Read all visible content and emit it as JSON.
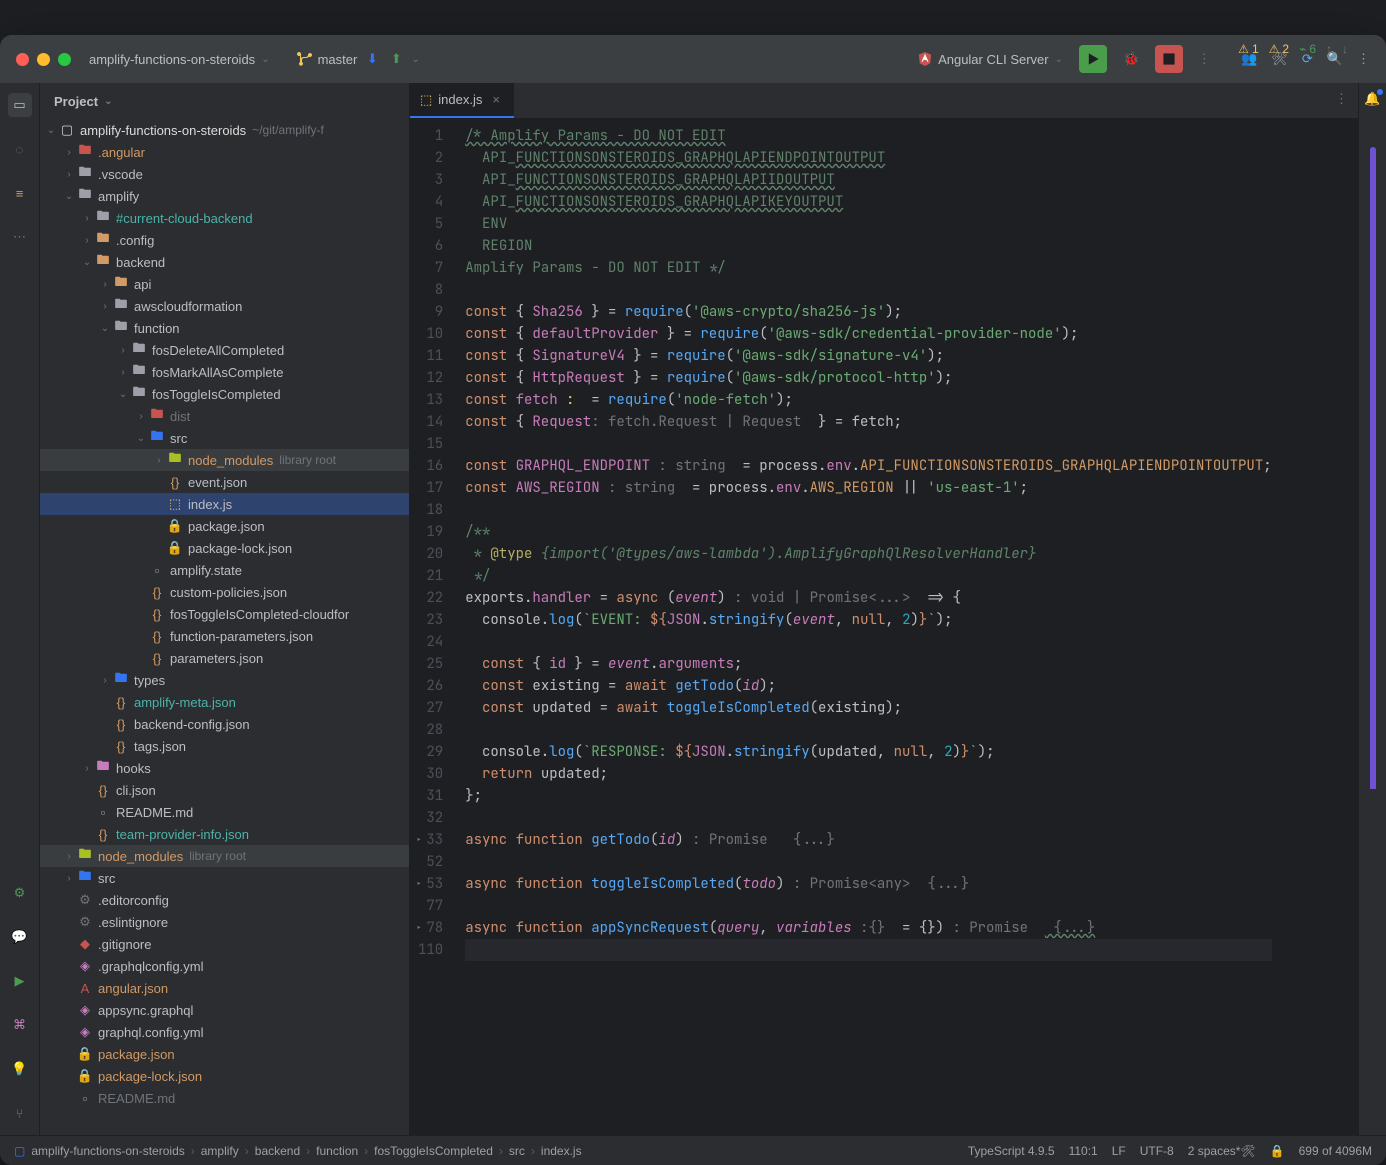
{
  "titlebar": {
    "project": "amplify-functions-on-steroids",
    "branch": "master",
    "run_config": "Angular CLI Server"
  },
  "sidebar": {
    "title": "Project"
  },
  "tree": [
    {
      "d": 0,
      "arr": "v",
      "ic": "folder-root",
      "name": "amplify-functions-on-steroids",
      "suf": "~/git/amplify-f",
      "cls": "white"
    },
    {
      "d": 1,
      "arr": ">",
      "ic": "folder-ng",
      "name": ".angular",
      "cls": "orange"
    },
    {
      "d": 1,
      "arr": ">",
      "ic": "folder",
      "name": ".vscode"
    },
    {
      "d": 1,
      "arr": "v",
      "ic": "folder",
      "name": "amplify"
    },
    {
      "d": 2,
      "arr": ">",
      "ic": "folder",
      "name": "#current-cloud-backend",
      "cls": "teal"
    },
    {
      "d": 2,
      "arr": ">",
      "ic": "folder-cfg",
      "name": ".config"
    },
    {
      "d": 2,
      "arr": "v",
      "ic": "folder-be",
      "name": "backend"
    },
    {
      "d": 3,
      "arr": ">",
      "ic": "folder-y",
      "name": "api"
    },
    {
      "d": 3,
      "arr": ">",
      "ic": "folder",
      "name": "awscloudformation"
    },
    {
      "d": 3,
      "arr": "v",
      "ic": "folder",
      "name": "function"
    },
    {
      "d": 4,
      "arr": ">",
      "ic": "folder",
      "name": "fosDeleteAllCompleted"
    },
    {
      "d": 4,
      "arr": ">",
      "ic": "folder",
      "name": "fosMarkAllAsComplete"
    },
    {
      "d": 4,
      "arr": "v",
      "ic": "folder",
      "name": "fosToggleIsCompleted"
    },
    {
      "d": 5,
      "arr": ">",
      "ic": "folder-red",
      "name": "dist",
      "cls": "grey"
    },
    {
      "d": 5,
      "arr": "v",
      "ic": "folder-src",
      "name": "src"
    },
    {
      "d": 6,
      "arr": ">",
      "ic": "folder-lib",
      "name": "node_modules",
      "suf": "library root",
      "cls": "orange",
      "hil": true
    },
    {
      "d": 6,
      "arr": "",
      "ic": "json",
      "name": "event.json"
    },
    {
      "d": 6,
      "arr": "",
      "ic": "js",
      "name": "index.js",
      "sel": true
    },
    {
      "d": 6,
      "arr": "",
      "ic": "json-r",
      "name": "package.json"
    },
    {
      "d": 6,
      "arr": "",
      "ic": "json-r",
      "name": "package-lock.json"
    },
    {
      "d": 5,
      "arr": "",
      "ic": "file",
      "name": "amplify.state"
    },
    {
      "d": 5,
      "arr": "",
      "ic": "json",
      "name": "custom-policies.json"
    },
    {
      "d": 5,
      "arr": "",
      "ic": "json",
      "name": "fosToggleIsCompleted-cloudfor"
    },
    {
      "d": 5,
      "arr": "",
      "ic": "json",
      "name": "function-parameters.json"
    },
    {
      "d": 5,
      "arr": "",
      "ic": "json",
      "name": "parameters.json"
    },
    {
      "d": 3,
      "arr": ">",
      "ic": "folder-ts",
      "name": "types"
    },
    {
      "d": 3,
      "arr": "",
      "ic": "json",
      "name": "amplify-meta.json",
      "cls": "teal"
    },
    {
      "d": 3,
      "arr": "",
      "ic": "json",
      "name": "backend-config.json"
    },
    {
      "d": 3,
      "arr": "",
      "ic": "json",
      "name": "tags.json"
    },
    {
      "d": 2,
      "arr": ">",
      "ic": "folder-p",
      "name": "hooks"
    },
    {
      "d": 2,
      "arr": "",
      "ic": "json",
      "name": "cli.json"
    },
    {
      "d": 2,
      "arr": "",
      "ic": "md",
      "name": "README.md"
    },
    {
      "d": 2,
      "arr": "",
      "ic": "json",
      "name": "team-provider-info.json",
      "cls": "teal"
    },
    {
      "d": 1,
      "arr": ">",
      "ic": "folder-lib",
      "name": "node_modules",
      "suf": "library root",
      "cls": "orange",
      "hil": true
    },
    {
      "d": 1,
      "arr": ">",
      "ic": "folder-src",
      "name": "src"
    },
    {
      "d": 1,
      "arr": "",
      "ic": "cfg",
      "name": ".editorconfig"
    },
    {
      "d": 1,
      "arr": "",
      "ic": "cfg",
      "name": ".eslintignore"
    },
    {
      "d": 1,
      "arr": "",
      "ic": "git",
      "name": ".gitignore"
    },
    {
      "d": 1,
      "arr": "",
      "ic": "gql",
      "name": ".graphqlconfig.yml"
    },
    {
      "d": 1,
      "arr": "",
      "ic": "ng",
      "name": "angular.json",
      "cls": "orange"
    },
    {
      "d": 1,
      "arr": "",
      "ic": "gql",
      "name": "appsync.graphql"
    },
    {
      "d": 1,
      "arr": "",
      "ic": "gql",
      "name": "graphql.config.yml"
    },
    {
      "d": 1,
      "arr": "",
      "ic": "json-r",
      "name": "package.json",
      "cls": "orange"
    },
    {
      "d": 1,
      "arr": "",
      "ic": "json-r",
      "name": "package-lock.json",
      "cls": "orange"
    },
    {
      "d": 1,
      "arr": "",
      "ic": "md",
      "name": "README.md",
      "cls": "grey"
    }
  ],
  "tab": {
    "name": "index.js"
  },
  "warnings": {
    "err": "1",
    "warn": "2",
    "weak": "6"
  },
  "code": {
    "lines": [
      1,
      2,
      3,
      4,
      5,
      6,
      7,
      8,
      9,
      10,
      11,
      12,
      13,
      14,
      15,
      16,
      17,
      18,
      19,
      20,
      21,
      22,
      23,
      24,
      25,
      26,
      27,
      28,
      29,
      30,
      31,
      32,
      33,
      52,
      53,
      77,
      78,
      110
    ],
    "l1a": "/* Amplify Params - DO NOT EDIT",
    "l2": "API_",
    "l2b": "FUNCTIONSONSTEROIDS_GRAPHQLAPIENDPOINTOUTPUT",
    "l3": "API_",
    "l3b": "FUNCTIONSONSTEROIDS_GRAPHQLAPIIDOUTPUT",
    "l4": "API_",
    "l4b": "FUNCTIONSONSTEROIDS_GRAPHQLAPIKEYOUTPUT",
    "l5": "ENV",
    "l6": "REGION",
    "l7": "Amplify Params - DO NOT EDIT */",
    "l9_kw": "const",
    "l9_b": "{ ",
    "l9_id": "Sha256",
    "l9_c": " } = ",
    "l9_fn": "require",
    "l9_s": "'@aws-crypto/sha256-js'",
    "l10_id": "defaultProvider",
    "l10_s": "'@aws-sdk/credential-provider-node'",
    "l11_id": "SignatureV4",
    "l11_s": "'@aws-sdk/signature-v4'",
    "l12_id": "HttpRequest",
    "l12_s": "'@aws-sdk/protocol-http'",
    "l13_id": "fetch",
    "l13_s": "'node-fetch'",
    "l14_id": "Request",
    "l14_t": ": fetch.Request | Request ",
    "l14_e": " = fetch;",
    "l16_id": "GRAPHQL_ENDPOINT",
    "l16_t": " : string ",
    "l16_e": " = process.",
    "l16_p": "env",
    "l16_q": ".",
    "l16_c": "API_FUNCTIONSONSTEROIDS_GRAPHQLAPIENDPOINTOUTPUT",
    "l17_id": "AWS_REGION",
    "l17_e": " = process.",
    "l17_c": "AWS_REGION",
    "l17_s": "'us-east-1'",
    "l19": "/**",
    "l20a": " * ",
    "l20b": "@type",
    "l20c": " {import('@types/aws-lambda').AmplifyGraphQlResolverHandler}",
    "l21": " */",
    "l22a": "exports.",
    "l22b": "handler",
    "l22c": " = ",
    "l22d": "async",
    "l22e": " (",
    "l22f": "event",
    "l22g": ")",
    "l22t": " : void | Promise<...> ",
    "l22h": " => {",
    "l23a": "console.",
    "l23b": "log",
    "l23c": "(",
    "l23d": "`EVENT: ",
    "l23e": "${",
    "l23f": "JSON",
    "l23g": ".",
    "l23h": "stringify",
    "l23i": "(",
    "l23j": "event",
    "l23k": ", ",
    "l23l": "null",
    "l23m": ", ",
    "l23n": "2",
    "l23o": ")}",
    "l23p": "`",
    "l23q": ");",
    "l25a": "const",
    "l25b": " { ",
    "l25c": "id",
    "l25d": " } = ",
    "l25e": "event",
    "l25f": ".",
    "l25g": "arguments",
    "l25h": ";",
    "l26a": "const",
    "l26b": " existing = ",
    "l26c": "await",
    "l26d": " ",
    "l26e": "getTodo",
    "l26f": "(",
    "l26g": "id",
    "l26h": ");",
    "l27a": "const",
    "l27b": " updated = ",
    "l27c": "await",
    "l27d": " ",
    "l27e": "toggleIsCompleted",
    "l27f": "(existing);",
    "l29a": "console.",
    "l29b": "log",
    "l29c": "(",
    "l29d": "`RESPONSE: ",
    "l29e": "${",
    "l29f": "JSON",
    "l29g": ".",
    "l29h": "stringify",
    "l29i": "(updated, ",
    "l29j": "null",
    "l29k": ", ",
    "l29l": "2",
    "l29m": ")}",
    "l29n": "`",
    "l29o": ");",
    "l30a": "return",
    "l30b": " updated;",
    "l31": "};",
    "l33a": "async function",
    "l33b": " ",
    "l33c": "getTodo",
    "l33d": "(",
    "l33e": "id",
    "l33f": ")",
    "l33t": " : Promise<any> ",
    "l33g": " {...}",
    "l53c": "toggleIsCompleted",
    "l53e": "todo",
    "l78c": "appSyncRequest",
    "l78e": "query",
    "l78f": ", ",
    "l78g": "variables",
    "l78t": " :{} ",
    "l78h": " = {}",
    ")": ")",
    "l78t2": " : Promise<any> ",
    "l78g2": " {...}"
  },
  "breadcrumb": [
    "amplify-functions-on-steroids",
    "amplify",
    "backend",
    "function",
    "fosToggleIsCompleted",
    "src",
    "index.js"
  ],
  "status": {
    "ts": "TypeScript 4.9.5",
    "pos": "110:1",
    "sep": "LF",
    "enc": "UTF-8",
    "indent": "2 spaces*",
    "mem": "699 of 4096M"
  }
}
